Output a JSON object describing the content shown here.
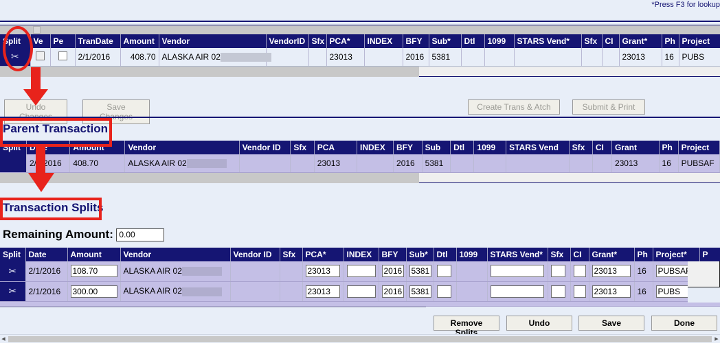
{
  "page": {
    "hint_text": "*Press F3 for lookup",
    "title_parent": "Parent Transaction",
    "title_splits": "Transaction Splits",
    "remaining_label": "Remaining Amount:",
    "remaining_value": "0.00"
  },
  "main_grid": {
    "columns": [
      "Split",
      "Ve",
      "Pe",
      "TranDate",
      "Amount",
      "Vendor",
      "VendorID",
      "Sfx",
      "PCA*",
      "INDEX",
      "BFY",
      "Sub*",
      "Dtl",
      "1099",
      "STARS Vend*",
      "Sfx",
      "CI",
      "Grant*",
      "Ph",
      "Project"
    ],
    "rows": [
      {
        "split_icon": "scissors-icon",
        "ve": "",
        "pe": "",
        "trandate": "2/1/2016",
        "amount": "408.70",
        "vendor": "ALASKA AIR 02",
        "vendorid": "",
        "sfx": "",
        "pca": "23013",
        "index": "",
        "bfy": "2016",
        "sub": "5381",
        "dtl": "",
        "n1099": "",
        "stars_vend": "",
        "sfx2": "",
        "ci": "",
        "grant": "23013",
        "ph": "16",
        "project": "PUBS"
      }
    ]
  },
  "action_bar": {
    "undo_changes": "Undo Changes",
    "save_changes": "Save Changes",
    "create_trans_atch": "Create Trans & Atch",
    "submit_print": "Submit & Print"
  },
  "parent_grid": {
    "columns": [
      "Split",
      "Date",
      "Amount",
      "Vendor",
      "Vendor ID",
      "Sfx",
      "PCA",
      "INDEX",
      "BFY",
      "Sub",
      "Dtl",
      "1099",
      "STARS Vend",
      "Sfx",
      "CI",
      "Grant",
      "Ph",
      "Project"
    ],
    "rows": [
      {
        "split_icon": "",
        "date": "2/1/2016",
        "amount": "408.70",
        "vendor": "ALASKA AIR 02",
        "vendorid": "",
        "sfx": "",
        "pca": "23013",
        "index": "",
        "bfy": "2016",
        "sub": "5381",
        "dtl": "",
        "n1099": "",
        "stars_vend": "",
        "sfx2": "",
        "ci": "",
        "grant": "23013",
        "ph": "16",
        "project": "PUBSAF"
      }
    ]
  },
  "splits_grid": {
    "columns": [
      "Split",
      "Date",
      "Amount",
      "Vendor",
      "Vendor ID",
      "Sfx",
      "PCA*",
      "INDEX",
      "BFY",
      "Sub*",
      "Dtl",
      "1099",
      "STARS Vend*",
      "Sfx",
      "CI",
      "Grant*",
      "Ph",
      "Project*",
      "P"
    ],
    "rows": [
      {
        "split_icon": "scissors-icon",
        "date": "2/1/2016",
        "amount": "108.70",
        "vendor": "ALASKA AIR 02",
        "vendorid": "",
        "sfx": "",
        "pca": "23013",
        "index": "",
        "bfy": "2016",
        "sub": "5381",
        "dtl": "",
        "n1099": "",
        "stars_vend": "",
        "sfx2": "",
        "ci": "",
        "grant": "23013",
        "ph": "16",
        "project": "PUBSAF"
      },
      {
        "split_icon": "scissors-icon",
        "date": "2/1/2016",
        "amount": "300.00",
        "vendor": "ALASKA AIR 02",
        "vendorid": "",
        "sfx": "",
        "pca": "23013",
        "index": "",
        "bfy": "2016",
        "sub": "5381",
        "dtl": "",
        "n1099": "",
        "stars_vend": "",
        "sfx2": "",
        "ci": "",
        "grant": "23013",
        "ph": "16",
        "project": "PUBS"
      }
    ]
  },
  "footer_bar": {
    "remove_splits": "Remove Splits",
    "undo": "Undo",
    "save": "Save",
    "done": "Done"
  },
  "colors": {
    "header_navy": "#151573",
    "row_light": "#e8eef8",
    "row_purple": "#c4bfe6",
    "annotation_red": "#e8231c"
  }
}
